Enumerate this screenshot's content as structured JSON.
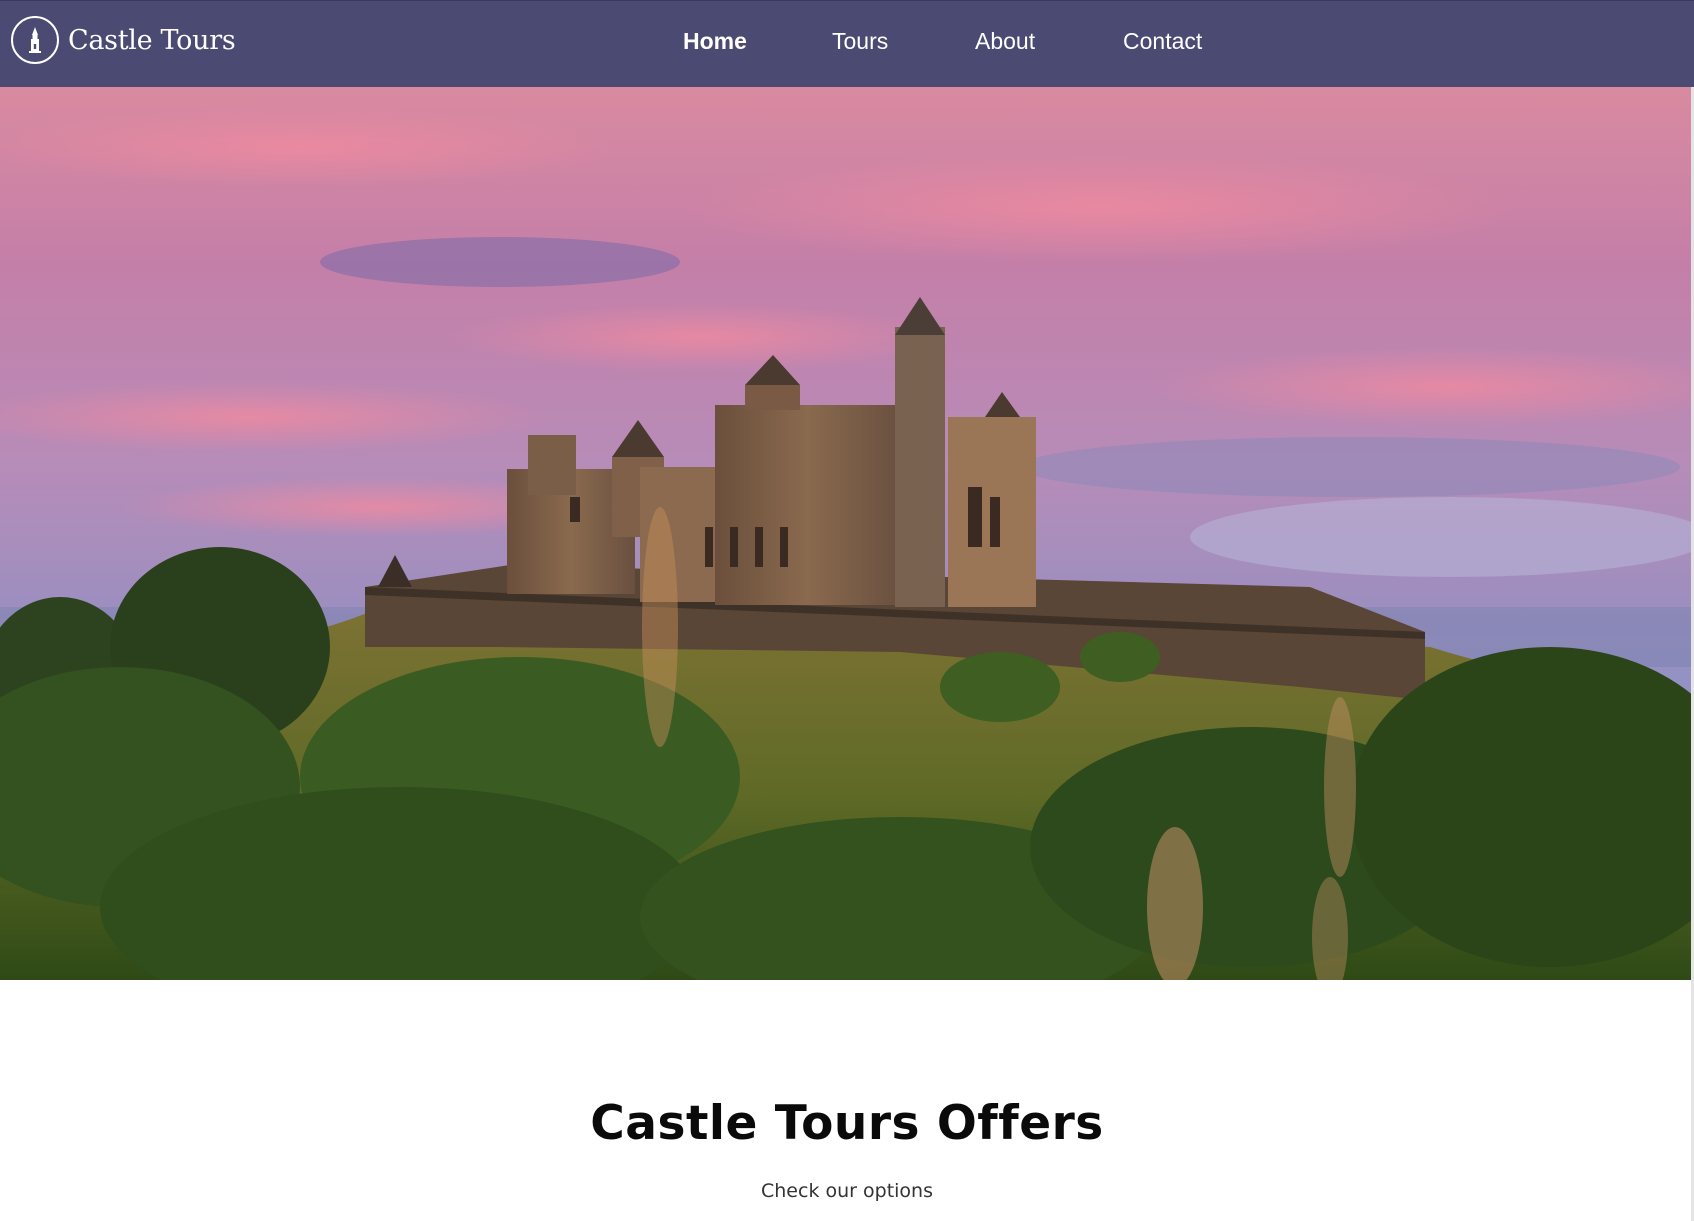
{
  "brand": {
    "name": "Castle Tours",
    "icon": "castle-tower-icon"
  },
  "nav": {
    "items": [
      {
        "label": "Home",
        "active": true
      },
      {
        "label": "Tours",
        "active": false
      },
      {
        "label": "About",
        "active": false
      },
      {
        "label": "Contact",
        "active": false
      }
    ]
  },
  "hero": {
    "image": "castle-on-hill-at-sunset"
  },
  "offers": {
    "title": "Castle Tours Offers",
    "subtitle": "Check our options"
  },
  "colors": {
    "navbar": "#4b4a73",
    "nav_text": "#ffffff",
    "title_text": "#0a0a0a",
    "subtitle_text": "#333333"
  }
}
